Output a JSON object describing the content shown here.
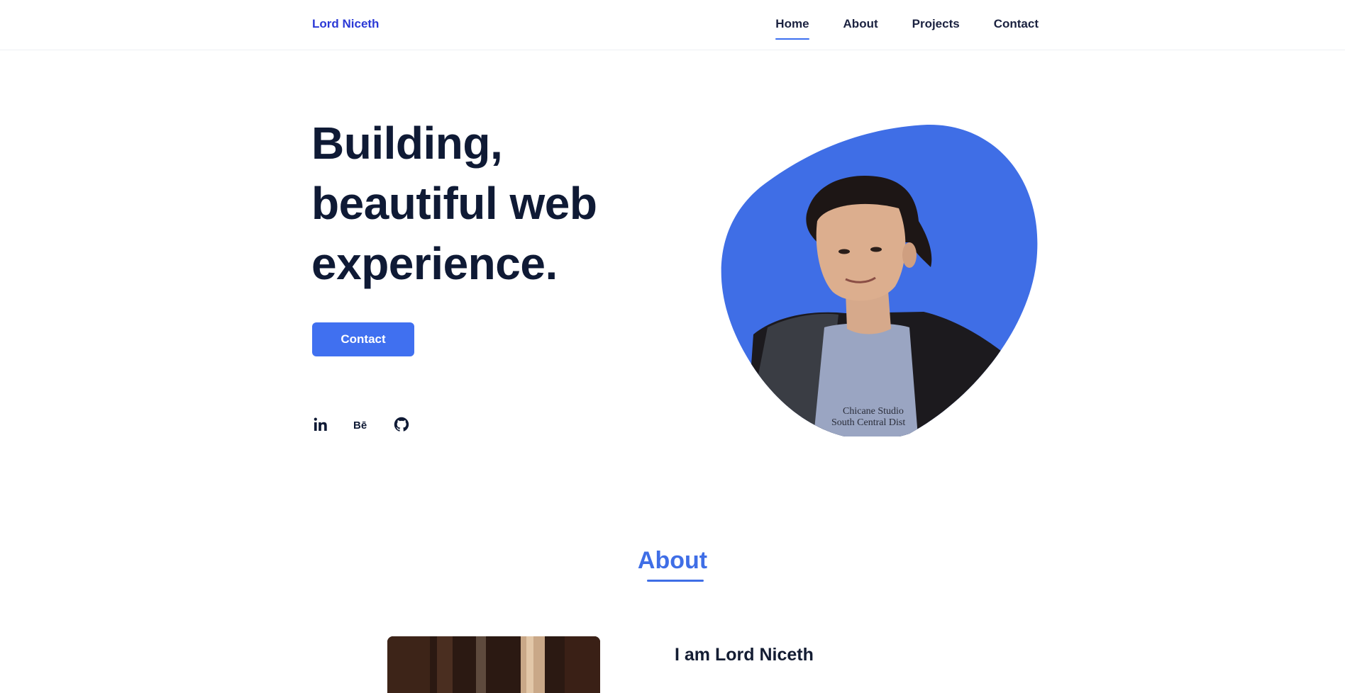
{
  "header": {
    "logo": "Lord Niceth",
    "nav": [
      {
        "label": "Home",
        "active": true
      },
      {
        "label": "About",
        "active": false
      },
      {
        "label": "Projects",
        "active": false
      },
      {
        "label": "Contact",
        "active": false
      }
    ]
  },
  "hero": {
    "title_lines": [
      "Building,",
      "beautiful web",
      "experience."
    ],
    "button_label": "Contact",
    "socials": [
      {
        "name": "linkedin-icon"
      },
      {
        "name": "behance-icon",
        "glyph": "Bē"
      },
      {
        "name": "github-icon"
      }
    ],
    "photo_print": [
      "Chicane Studio",
      "South Central Dist"
    ],
    "blob_color": "#3f6ee6"
  },
  "about": {
    "section_title": "About",
    "heading": "I am Lord Niceth"
  },
  "colors": {
    "accent": "#4070f0",
    "dark_text": "#0f1a35",
    "logo": "#2b39d6"
  }
}
